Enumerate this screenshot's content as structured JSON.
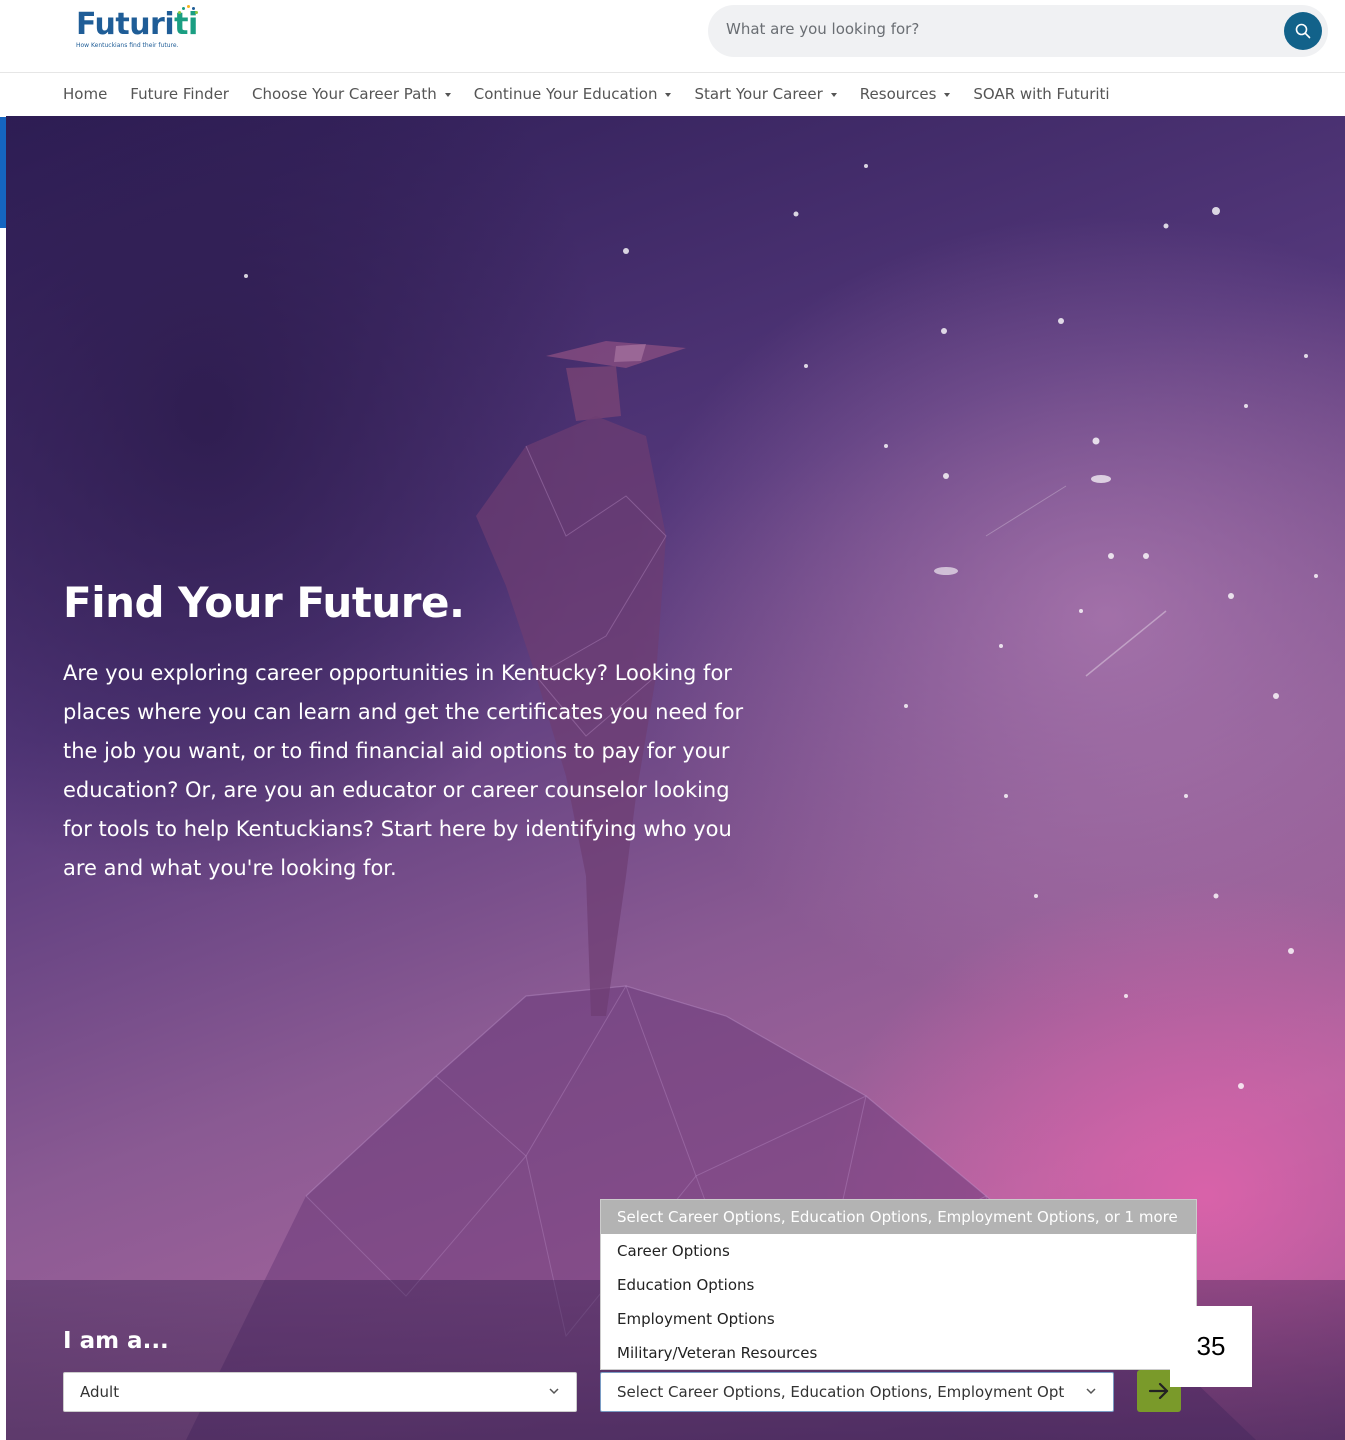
{
  "header": {
    "logo_text": "Futuriti",
    "logo_tagline": "How Kentuckians find their future.",
    "search_placeholder": "What are you looking for?"
  },
  "nav": {
    "items": [
      {
        "label": "Home",
        "dropdown": false
      },
      {
        "label": "Future Finder",
        "dropdown": false
      },
      {
        "label": "Choose Your Career Path",
        "dropdown": true
      },
      {
        "label": "Continue Your Education",
        "dropdown": true
      },
      {
        "label": "Start Your Career",
        "dropdown": true
      },
      {
        "label": "Resources",
        "dropdown": true
      },
      {
        "label": "SOAR with Futuriti",
        "dropdown": false
      }
    ]
  },
  "hero": {
    "title": "Find Your Future.",
    "body": "Are you exploring career opportunities in Kentucky? Looking for places where you can learn and get the certificates you need for the job you want, or to find financial aid options to pay for your education? Or, are you an educator or career counselor looking for tools to help Kentuckians? Start here by identifying who you are and what you're looking for."
  },
  "form": {
    "iam_label": "I am a...",
    "role_value": "Adult",
    "options_value": "Select Career Options, Education Options, Employment Opt",
    "dropdown_header": "Select Career Options, Education Options, Employment Options, or 1 more",
    "dropdown_options": [
      "Career Options",
      "Education Options",
      "Employment Options",
      "Military/Veteran Resources"
    ]
  },
  "page_number": "35",
  "colors": {
    "brand_blue": "#1f5d97",
    "search_button": "#12628a",
    "go_button": "#7a9a2a"
  }
}
